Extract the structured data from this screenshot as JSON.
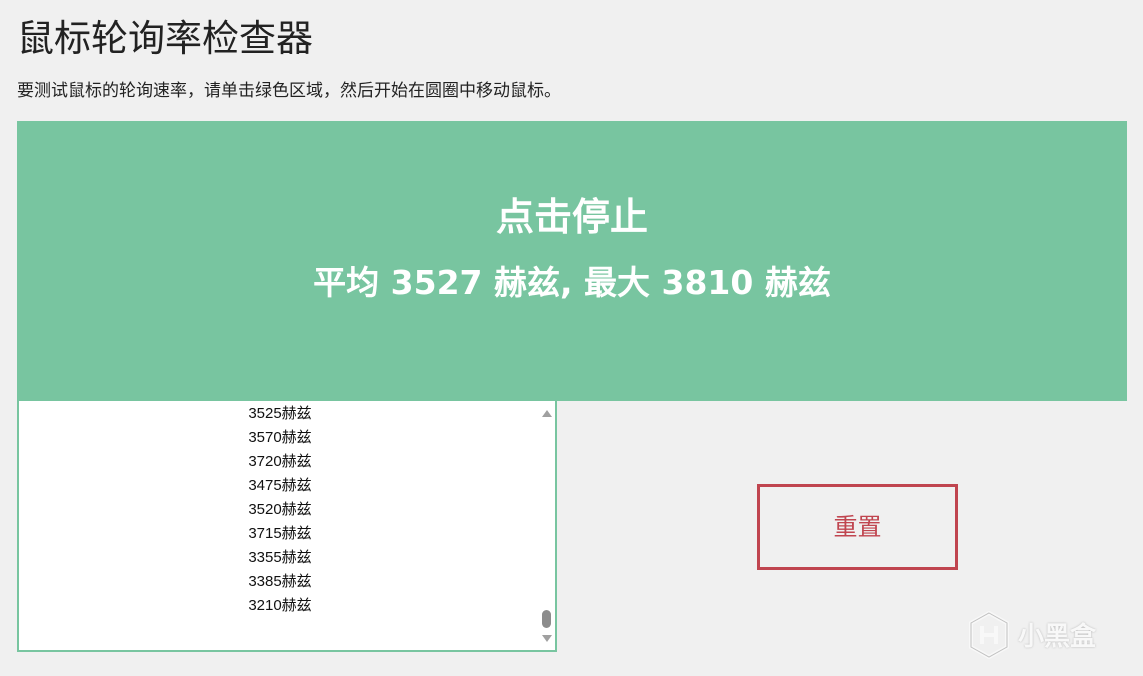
{
  "page": {
    "title": "鼠标轮询率检查器",
    "instructions": "要测试鼠标的轮询速率，请单击绿色区域，然后开始在圆圈中移动鼠标。"
  },
  "green_area": {
    "title": "点击停止",
    "stats": "平均 3527 赫兹, 最大 3810 赫兹"
  },
  "readings": [
    "3525赫兹",
    "3570赫兹",
    "3720赫兹",
    "3475赫兹",
    "3520赫兹",
    "3715赫兹",
    "3355赫兹",
    "3385赫兹",
    "3210赫兹"
  ],
  "reset_button": {
    "label": "重置"
  },
  "watermark": {
    "text": "小黑盒"
  },
  "colors": {
    "green": "#78c5a0",
    "reset_red": "#c0454f",
    "background": "#f0f0f0"
  }
}
